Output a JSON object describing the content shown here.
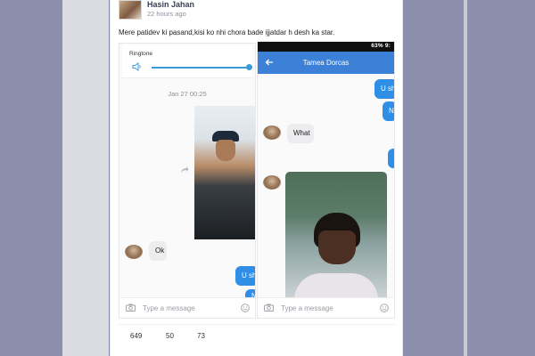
{
  "post": {
    "author": "Hasin Jahan",
    "time": "22 hours ago",
    "caption": "Mere patidev ki pasand,kisi ko nhi chora bade ijjatdar h desh ka star."
  },
  "left_screenshot": {
    "ringtone_label": "Ringtone",
    "date": "Jan 27 00:25",
    "incoming": [
      "Ok"
    ],
    "outgoing": [
      "U sh",
      "N"
    ],
    "compose_placeholder": "Type a message"
  },
  "right_screenshot": {
    "status": "63% 9:",
    "contact_name": "Tamea Dorcas",
    "incoming": [
      "What"
    ],
    "outgoing": [
      "U sh",
      "N",
      "I"
    ],
    "compose_placeholder": "Type a message"
  },
  "stats": {
    "reactions": "649",
    "comments": "50",
    "shares": "73"
  },
  "colors": {
    "accent_blue": "#3c81d7",
    "bubble_blue": "#2f8fe6",
    "page_bg": "#8b8fab"
  }
}
